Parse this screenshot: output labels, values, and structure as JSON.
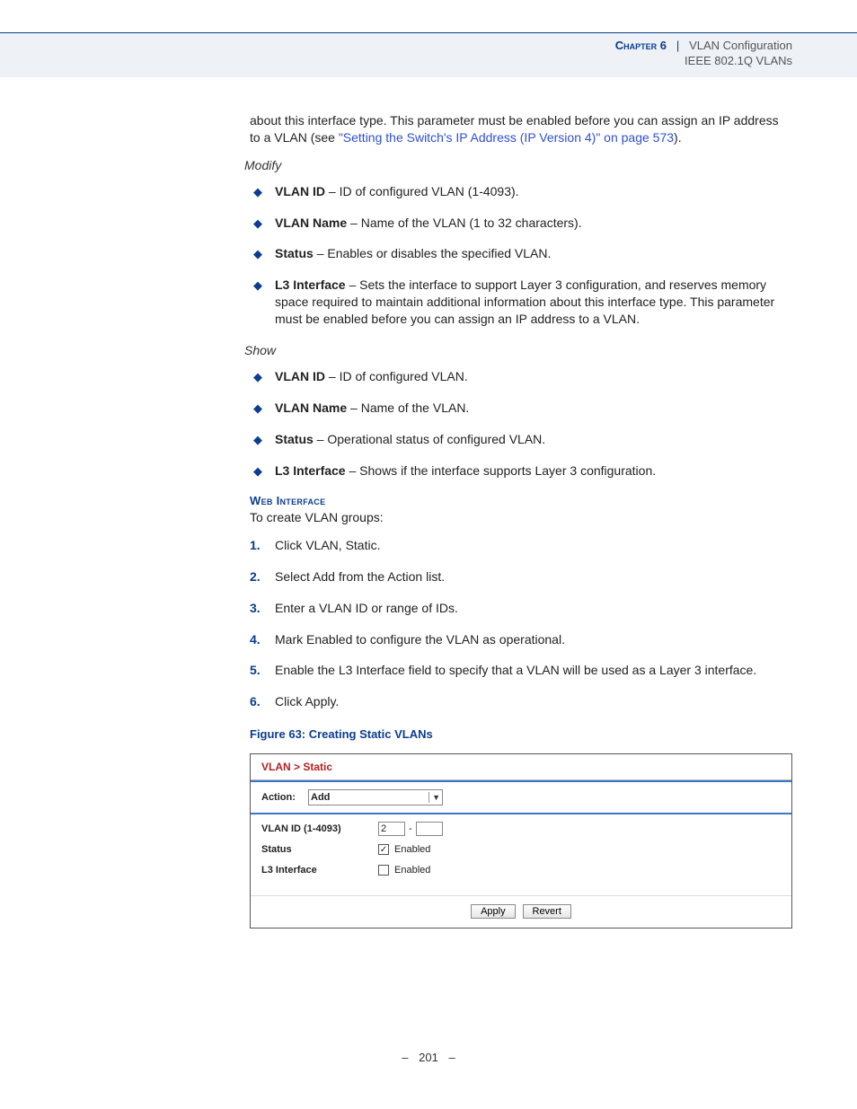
{
  "header": {
    "chapter": "Chapter 6",
    "sep": "|",
    "title": "VLAN Configuration",
    "sub": "IEEE 802.1Q VLANs"
  },
  "intro": {
    "p1a": "about this interface type. This parameter must be enabled before you can assign an IP address to a VLAN (see ",
    "link": "\"Setting the Switch's IP Address (IP Version 4)\" on page 573",
    "p1b": ")."
  },
  "modify": {
    "heading": "Modify",
    "items": [
      {
        "term": "VLAN ID",
        "desc": " – ID of configured VLAN (1-4093)."
      },
      {
        "term": "VLAN Name",
        "desc": " – Name of the VLAN (1 to 32 characters)."
      },
      {
        "term": "Status",
        "desc": " – Enables or disables the specified VLAN."
      },
      {
        "term": "L3 Interface",
        "desc": " – Sets the interface to support Layer 3 configuration, and reserves memory space required to maintain additional information about this interface type. This parameter must be enabled before you can assign an IP address to a VLAN."
      }
    ]
  },
  "show": {
    "heading": "Show",
    "items": [
      {
        "term": "VLAN ID",
        "desc": " – ID of configured VLAN."
      },
      {
        "term": "VLAN Name",
        "desc": " – Name of the VLAN."
      },
      {
        "term": "Status",
        "desc": " – Operational status of configured VLAN."
      },
      {
        "term": "L3 Interface",
        "desc": " – Shows if the interface supports Layer 3 configuration."
      }
    ]
  },
  "web": {
    "heading": "Web Interface",
    "intro": "To create VLAN groups:",
    "steps": [
      "Click VLAN, Static.",
      "Select Add from the Action list.",
      "Enter a VLAN ID or range of IDs.",
      "Mark Enabled to configure the VLAN as operational.",
      "Enable the L3 Interface field to specify that a VLAN will be used as a Layer 3 interface.",
      "Click Apply."
    ]
  },
  "figure": {
    "caption": "Figure 63:  Creating Static VLANs"
  },
  "shot": {
    "breadcrumb": "VLAN > Static",
    "action_label": "Action:",
    "action_value": "Add",
    "vlan_id_label": "VLAN ID (1-4093)",
    "vlan_id_from": "2",
    "vlan_id_to": "",
    "dash": "-",
    "status_label": "Status",
    "status_text": "Enabled",
    "status_checked": "✓",
    "l3_label": "L3 Interface",
    "l3_text": "Enabled",
    "l3_checked": "",
    "btn_apply": "Apply",
    "btn_revert": "Revert"
  },
  "footer": {
    "dash": "–",
    "page": "201"
  }
}
